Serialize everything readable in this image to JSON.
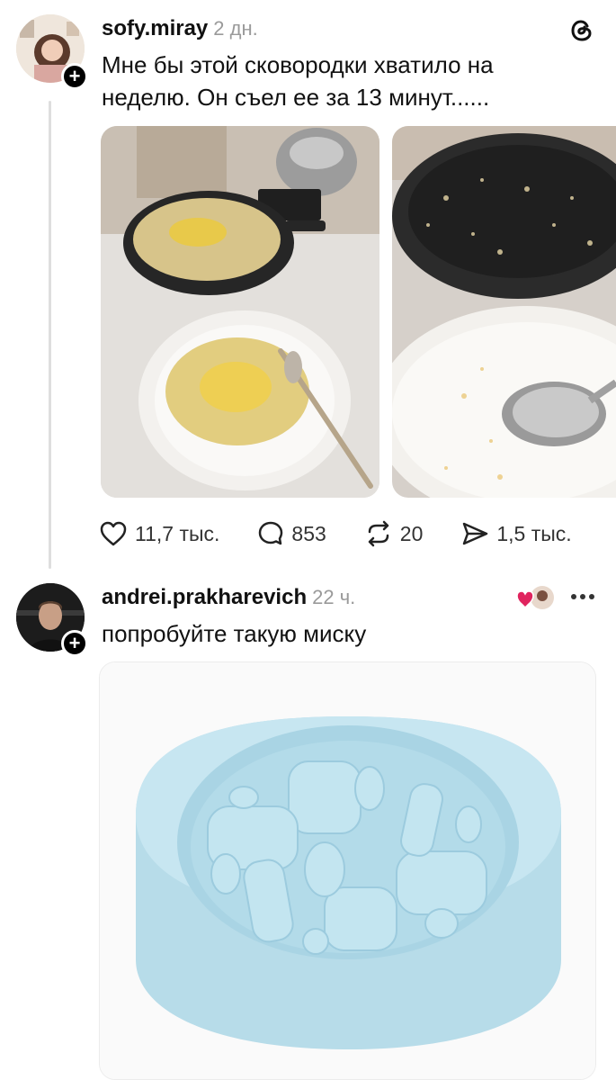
{
  "post1": {
    "username": "sofy.miray",
    "time": "2 дн.",
    "text_line1": "Мне бы этой сковородки хватило на",
    "text_line2": "неделю. Он съел ее за 13 минут......",
    "likes": "11,7 тыс.",
    "comments": "853",
    "reposts": "20",
    "shares": "1,5 тыс.",
    "app_icon": "threads-logo-icon"
  },
  "post2": {
    "username": "andrei.prakharevich",
    "time": "22 ч.",
    "text": "попробуйте такую миску",
    "more_icon": "more-dots-icon"
  },
  "colors": {
    "bowl": "#bfe3ef",
    "like_heart": "#e0245e"
  }
}
